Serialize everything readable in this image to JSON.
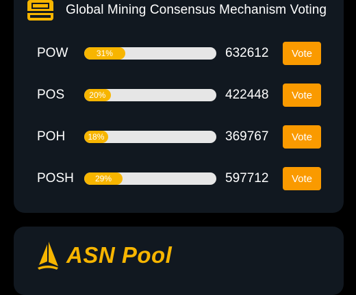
{
  "header": {
    "title": "Global Mining Consensus Mechanism Voting",
    "icon": "ballot-box-icon"
  },
  "mechanisms": [
    {
      "label": "POW",
      "percent": "31%",
      "percent_value": 31,
      "count": "632612",
      "button": "Vote"
    },
    {
      "label": "POS",
      "percent": "20%",
      "percent_value": 20,
      "count": "422448",
      "button": "Vote"
    },
    {
      "label": "POH",
      "percent": "18%",
      "percent_value": 18,
      "count": "369767",
      "button": "Vote"
    },
    {
      "label": "POSH",
      "percent": "29%",
      "percent_value": 29,
      "count": "597712",
      "button": "Vote"
    }
  ],
  "pool": {
    "name": "ASN Pool",
    "icon": "sail-logo-icon"
  },
  "colors": {
    "background": "#000000",
    "card": "#111820",
    "accent": "#f7b500",
    "button": "#fa9a00",
    "track": "#e6e6e6"
  }
}
